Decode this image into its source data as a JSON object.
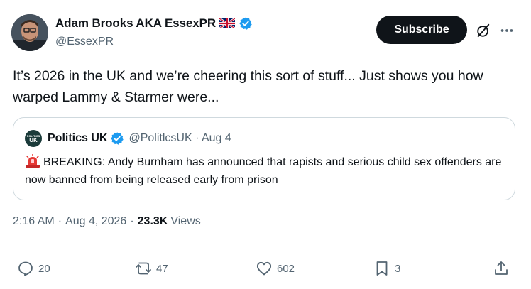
{
  "author": {
    "name": "Adam Brooks AKA EssexPR",
    "handle": "@EssexPR"
  },
  "subscribe_label": "Subscribe",
  "tweet_text": "It’s 2026 in the UK and we’re cheering this sort of stuff... Just shows you how warped Lammy & Starmer were...",
  "quote": {
    "avatar_text_line1": "POLITICS",
    "avatar_text_line2": "UK",
    "name": "Politics UK",
    "handle": "@PolitlcsUK · Aug 4",
    "text": "BREAKING: Andy Burnham has announced that rapists and serious child sex offenders are now banned from being released early from prison"
  },
  "meta": {
    "time": "2:16 AM",
    "date": "Aug 4, 2026",
    "views_count": "23.3K",
    "views_label": "Views"
  },
  "actions": {
    "replies": "20",
    "reposts": "47",
    "likes": "602",
    "bookmarks": "3"
  },
  "colors": {
    "verified": "#1d9bf0",
    "text_secondary": "#536471",
    "subscribe_bg": "#0f1419"
  }
}
